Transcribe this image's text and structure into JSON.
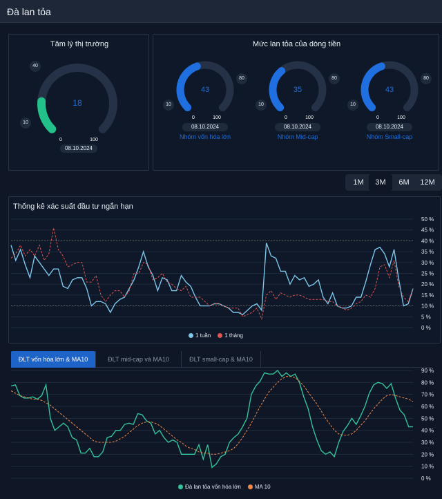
{
  "header": {
    "title": "Đà lan tỏa"
  },
  "sentiment": {
    "title": "Tâm lý thị trường",
    "value": "18",
    "min": "0",
    "max": "100",
    "low_mark": "10",
    "high_mark": "40",
    "date": "08.10.2024",
    "fraction": 0.18,
    "color": "#22c18a"
  },
  "flow": {
    "title": "Mức lan tỏa của dòng tiền",
    "gauges": [
      {
        "value": "43",
        "fraction": 0.43,
        "min": "0",
        "max": "100",
        "low_mark": "10",
        "high_mark": "80",
        "date": "08.10.2024",
        "label": "Nhóm vốn hóa lớn"
      },
      {
        "value": "35",
        "fraction": 0.35,
        "min": "0",
        "max": "100",
        "low_mark": "10",
        "high_mark": "80",
        "date": "08.10.2024",
        "label": "Nhóm Mid-cap"
      },
      {
        "value": "43",
        "fraction": 0.43,
        "min": "0",
        "max": "100",
        "low_mark": "10",
        "high_mark": "80",
        "date": "08.10.2024",
        "label": "Nhóm Small-cap"
      }
    ],
    "color": "#1f6fe0"
  },
  "range": {
    "options": [
      "1M",
      "3M",
      "6M",
      "12M"
    ],
    "selected": "3M"
  },
  "chart_data": [
    {
      "type": "line",
      "title": "Thống kê xác suất đầu tư ngắn hạn",
      "ylim": [
        0,
        50
      ],
      "y_ticks": [
        "50 %",
        "45 %",
        "40 %",
        "35 %",
        "30 %",
        "25 %",
        "20 %",
        "15 %",
        "10 %",
        "5 %",
        "0 %"
      ],
      "reference_lines": [
        40,
        10
      ],
      "legend_position": "bottom",
      "series": [
        {
          "name": "1 tuần",
          "color": "#7cc6ea",
          "values": [
            38,
            31,
            36,
            29,
            23,
            33,
            30,
            27,
            24,
            27,
            27,
            19,
            18,
            22,
            23,
            23,
            18,
            10,
            12,
            12,
            11,
            7,
            11,
            13,
            14,
            18,
            22,
            28,
            35,
            28,
            24,
            17,
            23,
            22,
            17,
            17,
            24,
            21,
            19,
            14,
            10,
            10,
            10,
            11,
            11,
            10,
            9,
            7,
            7,
            6,
            8,
            10,
            11,
            8,
            39,
            33,
            32,
            26,
            26,
            20,
            24,
            22,
            23,
            19,
            20,
            22,
            14,
            11,
            16,
            10,
            9,
            9,
            10,
            14,
            14,
            21,
            29,
            36,
            37,
            34,
            28,
            36,
            22,
            10,
            11,
            18
          ]
        },
        {
          "name": "1 tháng",
          "color": "#e0544f",
          "values": [
            32,
            34,
            38,
            33,
            36,
            33,
            38,
            31,
            34,
            46,
            36,
            33,
            28,
            29,
            30,
            30,
            21,
            21,
            24,
            15,
            12,
            15,
            17,
            17,
            14,
            17,
            25,
            25,
            30,
            29,
            22,
            23,
            25,
            21,
            20,
            18,
            17,
            19,
            14,
            14,
            14,
            12,
            10,
            11,
            11,
            10,
            9,
            9,
            9,
            5,
            6,
            7,
            9,
            4,
            15,
            17,
            13,
            16,
            15,
            14,
            15,
            15,
            14,
            13,
            13,
            13,
            13,
            12,
            12,
            10,
            9,
            8,
            9,
            11,
            12,
            15,
            14,
            18,
            28,
            29,
            23,
            31,
            19,
            14,
            12,
            18
          ]
        }
      ]
    },
    {
      "type": "line",
      "tabs": [
        "ĐLT vốn hóa lớn & MA10",
        "ĐLT mid-cap và MA10",
        "ĐLT small-cap & MA10"
      ],
      "selected_tab": "ĐLT vốn hóa lớn & MA10",
      "ylim": [
        0,
        90
      ],
      "y_ticks": [
        "90 %",
        "80 %",
        "70 %",
        "60 %",
        "50 %",
        "40 %",
        "30 %",
        "20 %",
        "10 %",
        "0 %"
      ],
      "legend_position": "bottom",
      "series": [
        {
          "name": "Đà lan tỏa vốn hóa lớn",
          "color": "#35c29a",
          "values": [
            77,
            78,
            69,
            67,
            67,
            68,
            66,
            69,
            78,
            50,
            40,
            43,
            46,
            43,
            34,
            32,
            21,
            21,
            25,
            18,
            18,
            22,
            34,
            35,
            40,
            40,
            45,
            46,
            45,
            54,
            53,
            48,
            46,
            37,
            40,
            34,
            30,
            32,
            30,
            20,
            20,
            20,
            20,
            28,
            16,
            28,
            9,
            12,
            18,
            20,
            30,
            34,
            37,
            43,
            50,
            70,
            77,
            81,
            88,
            87,
            87,
            90,
            85,
            88,
            85,
            87,
            80,
            68,
            58,
            43,
            32,
            23,
            20,
            22,
            18,
            30,
            39,
            44,
            50,
            45,
            52,
            60,
            71,
            78,
            80,
            79,
            75,
            79,
            67,
            57,
            53,
            43,
            43
          ]
        },
        {
          "name": "MA 10",
          "color": "#f08a4b",
          "values": [
            73,
            71,
            69,
            68,
            67,
            66,
            66,
            65,
            63,
            61,
            58,
            55,
            52,
            49,
            46,
            43,
            40,
            37,
            34,
            31,
            30,
            30,
            30,
            30,
            31,
            33,
            35,
            38,
            41,
            44,
            46,
            47,
            47,
            46,
            44,
            41,
            38,
            35,
            32,
            30,
            27,
            25,
            24,
            22,
            21,
            21,
            20,
            20,
            21,
            22,
            23,
            25,
            29,
            34,
            40,
            46,
            53,
            60,
            66,
            72,
            76,
            80,
            83,
            85,
            85,
            84,
            81,
            77,
            72,
            67,
            62,
            56,
            50,
            45,
            40,
            37,
            36,
            36,
            37,
            40,
            44,
            48,
            53,
            58,
            62,
            66,
            69,
            70,
            69,
            68,
            67,
            66,
            64
          ]
        }
      ]
    }
  ]
}
